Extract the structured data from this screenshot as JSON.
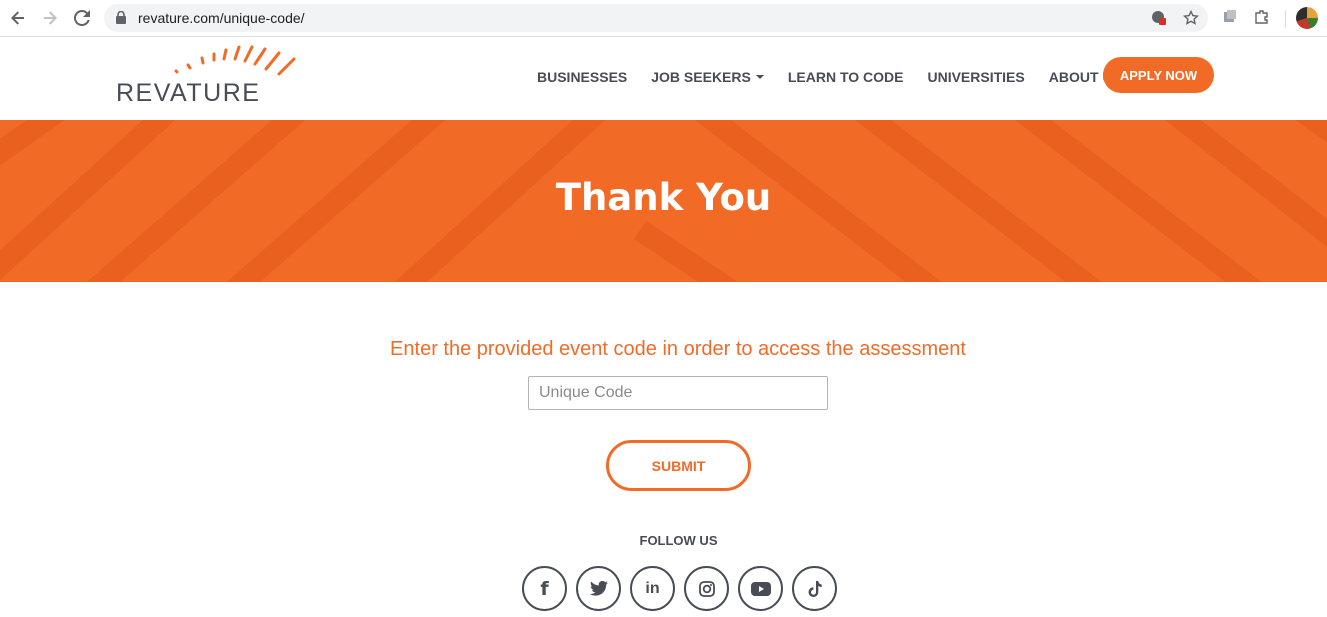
{
  "browser": {
    "url": "revature.com/unique-code/"
  },
  "header": {
    "logo_text": "REVATURE",
    "nav": [
      {
        "label": "BUSINESSES",
        "dropdown": false
      },
      {
        "label": "JOB SEEKERS",
        "dropdown": true
      },
      {
        "label": "LEARN TO CODE",
        "dropdown": false
      },
      {
        "label": "UNIVERSITIES",
        "dropdown": false
      },
      {
        "label": "ABOUT US",
        "dropdown": true
      }
    ],
    "apply_label": "APPLY NOW"
  },
  "hero": {
    "title": "Thank You"
  },
  "form": {
    "prompt": "Enter the provided event code in order to access the assessment",
    "code_placeholder": "Unique Code",
    "code_value": "",
    "submit_label": "SUBMIT"
  },
  "footer": {
    "follow_label": "FOLLOW US",
    "social": [
      {
        "icon": "facebook-icon",
        "glyph": "f"
      },
      {
        "icon": "twitter-icon",
        "glyph": ""
      },
      {
        "icon": "linkedin-icon",
        "glyph": "in"
      },
      {
        "icon": "instagram-icon",
        "glyph": ""
      },
      {
        "icon": "youtube-icon",
        "glyph": ""
      },
      {
        "icon": "tiktok-icon",
        "glyph": ""
      }
    ]
  },
  "colors": {
    "brand_orange": "#f26b26",
    "text_dark": "#474c55"
  }
}
